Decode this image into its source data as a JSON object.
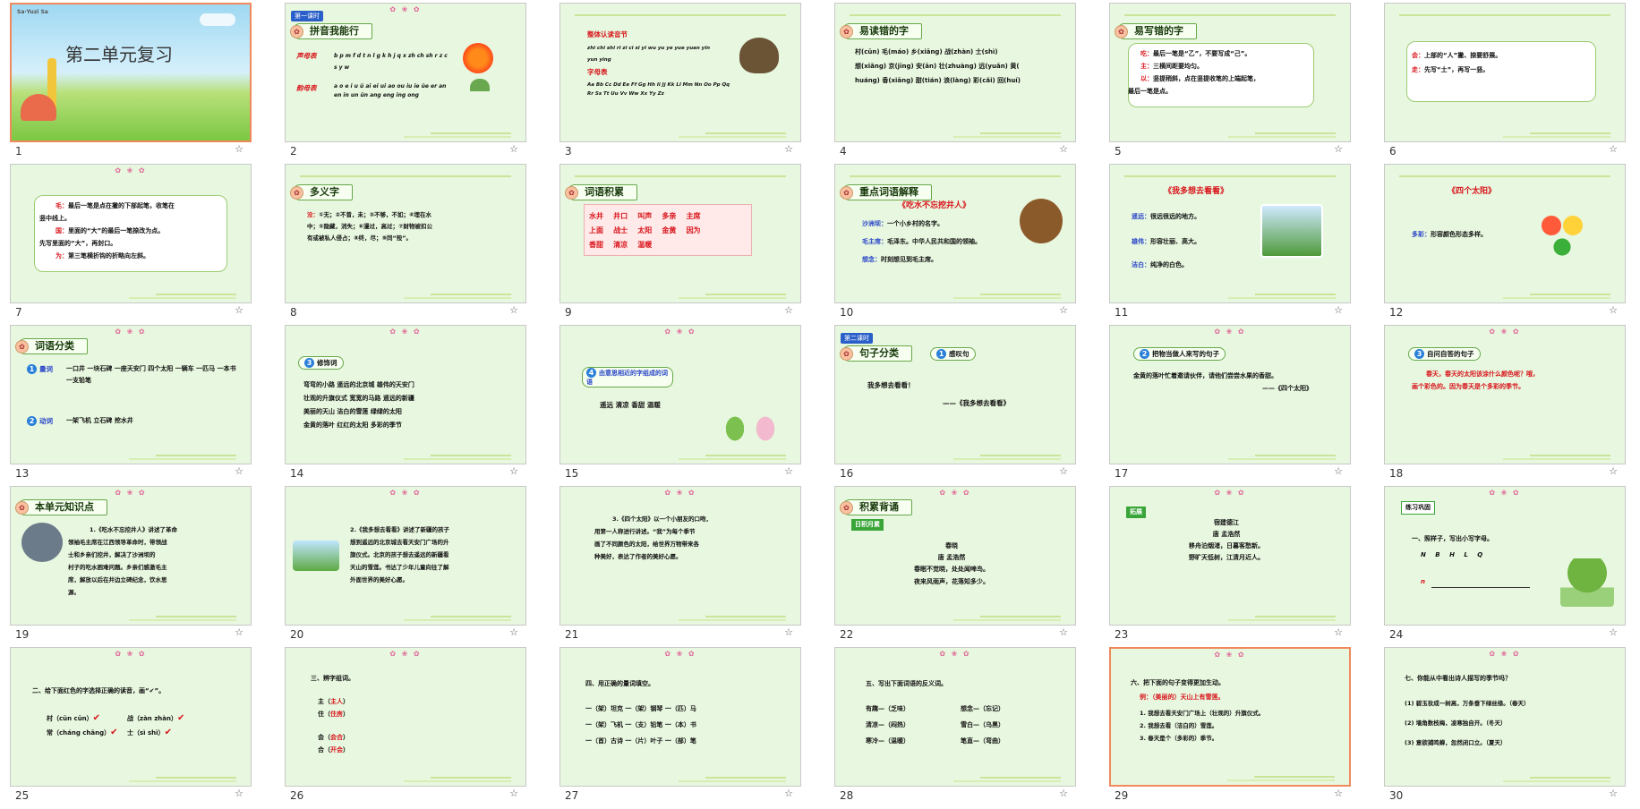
{
  "slides": [
    {
      "num": "1",
      "header": "Sa·Yuzi Sa",
      "title": "第二单元复习"
    },
    {
      "num": "2",
      "section": "第一课时",
      "tab": "拼音我能行",
      "l1": "声母表",
      "t1": "b p m f d t n l g k h j q x zh ch sh r z c s y w",
      "l2": "韵母表",
      "t2": "a o e i u ü ai ei ui ao ou iu ie üe er an en in un ün ang eng ing ong"
    },
    {
      "num": "3",
      "l1": "整体认读音节",
      "t1": "zhi chi shi ri zi ci si yi wu yu ye yue yuan yin yun ying",
      "l2": "字母表",
      "t2": "Aa Bb Cc Dd Ee Ff Gg Hh Ii Jj Kk Ll Mm Nn Oo Pp Qq Rr Ss Tt Uu Vv Ww Xx Yy Zz"
    },
    {
      "num": "4",
      "tab": "易读错的字",
      "l1": "村(cūn) 毛(máo) 乡(xiāng) 战(zhàn) 士(shì)",
      "l2": "想(xiǎng) 京(jīng) 安(ān) 壮(zhuàng) 远(yuǎn) 黄(",
      "l3": "huáng) 香(xiāng) 甜(tián) 浪(làng) 彩(cǎi) 回(huí)"
    },
    {
      "num": "5",
      "tab": "易写错的字",
      "k1": "吃：",
      "v1": "最后一笔是“乙”，不要写成“己”。",
      "k2": "主：",
      "v2": "三横间距要均匀。",
      "k3": "以：",
      "v3": "竖提稍斜，点在竖提收笔的上端起笔，",
      "v4": "最后一笔是点。"
    },
    {
      "num": "6",
      "k1": "会：",
      "v1": "上部的“人”撇、捺要舒展。",
      "k2": "走：",
      "v2": "先写“土”，再写一竖。"
    },
    {
      "num": "7",
      "k1": "毛：",
      "v1": "最后一笔是点在撇的下部起笔，收笔在",
      "v1b": "竖中线上。",
      "k2": "国：",
      "v2": "里面的“大”的最后一笔捺改为点。",
      "v2b": "先写里面的“大”，再封口。",
      "k3": "为：",
      "v3": "第三笔横折钩的折略向左斜。"
    },
    {
      "num": "8",
      "tab": "多义字",
      "k1": "没：",
      "v1": "①无；②不曾，未；③不够，不如；④埋在水",
      "v2": "中；⑤隐藏，消失；⑥漫过，高过；⑦财物被扣公",
      "v3": "有或被私人侵占；⑧终，尽；⑨同“殁”。"
    },
    {
      "num": "9",
      "tab": "词语积累",
      "words": [
        "水井",
        "井口",
        "叫声",
        "多亲",
        "主席",
        "上面",
        "战士",
        "太阳",
        "金黄",
        "因为",
        "香甜",
        "清凉",
        "温暖"
      ]
    },
    {
      "num": "10",
      "tab": "重点词语解释",
      "ttl": "《吃水不忘挖井人》",
      "k1": "沙洲坝：",
      "v1": "一个小乡村的名字。",
      "k2": "毛主席：",
      "v2": "毛泽东。中华人民共和国的领袖。",
      "k3": "想念：",
      "v3": "时刻想见到毛主席。"
    },
    {
      "num": "11",
      "ttl": "《我多想去看看》",
      "k1": "遥远：",
      "v1": "很远很远的地方。",
      "k2": "雄伟：",
      "v2": "形容壮丽、高大。",
      "k3": "洁白：",
      "v3": "纯净的白色。"
    },
    {
      "num": "12",
      "ttl": "《四个太阳》",
      "k1": "多彩：",
      "v1": "形容颜色形态多样。"
    },
    {
      "num": "13",
      "tab": "词语分类",
      "b1": "量词",
      "r1": "一口井 一块石碑 一座天安门 四个太阳 一辆车 一匹马 一本书 一支铅笔",
      "b2": "动词",
      "r2": "一架飞机 立石碑 挖水井"
    },
    {
      "num": "14",
      "tab": "修饰词",
      "r1": "弯弯的小路 遥远的北京城 雄伟的天安门",
      "r2": "壮观的升旗仪式 宽宽的马路 遥远的新疆",
      "r3": "美丽的天山 洁白的雪莲 绿绿的太阳",
      "r4": "金黄的落叶 红红的太阳 多彩的季节"
    },
    {
      "num": "15",
      "b1": "由意思相近的字组成的词语",
      "r1": "遥远 清凉 香甜 温暖"
    },
    {
      "num": "16",
      "section": "第二课时",
      "tab": "句子分类",
      "b1": "感叹句",
      "r1": "我多想去看看！",
      "r2": "——《我多想去看看》"
    },
    {
      "num": "17",
      "b1": "把物当做人来写的句子",
      "r1": "金黄的落叶忙着邀请伙伴，请他们尝尝水果的香甜。",
      "r2": "——《四个太阳》"
    },
    {
      "num": "18",
      "b1": "自问自答的句子",
      "r1": "春天，春天的太阳该涂什么颜色呢？哦，",
      "r2": "画个彩色的。因为春天是个多彩的季节。"
    },
    {
      "num": "19",
      "tab": "本单元知识点",
      "r1": "1.《吃水不忘挖井人》讲述了革命",
      "r2": "领袖毛主席在江西领导革命时，带领战",
      "r3": "士和乡亲们挖井，解决了沙洲坝的",
      "r4": "村子的吃水困难问题。乡亲们感激毛主",
      "r5": "席，解放以后在井边立碑纪念，饮水思",
      "r6": "源。"
    },
    {
      "num": "20",
      "r1": "2.《我多想去看看》讲述了新疆的孩子",
      "r2": "想到遥远的北京城去看天安门广场的升",
      "r3": "旗仪式。北京的孩子想去遥远的新疆看",
      "r4": "天山的雪莲。书达了少年儿童向往了解",
      "r5": "外面世界的美好心愿。"
    },
    {
      "num": "21",
      "r1": "3.《四个太阳》以一个小朋友的口吻，",
      "r2": "用第一人称进行讲述。“我”为每个季节",
      "r3": "画了不同颜色的太阳，给世界万物带来各",
      "r4": "种美好，表达了作者的美好心愿。"
    },
    {
      "num": "22",
      "tab": "积累背诵",
      "tag": "日积月累",
      "r1": "春晓",
      "r2": "唐 孟浩然",
      "r3": "春眠不觉晓，处处闻啼鸟。",
      "r4": "夜来风雨声，花落知多少。"
    },
    {
      "num": "23",
      "tag": "拓展",
      "r1": "宿建德江",
      "r2": "唐 孟浩然",
      "r3": "移舟泊烟渚，日暮客愁新。",
      "r4": "野旷天低树，江清月近人。"
    },
    {
      "num": "24",
      "tag": "练习巩固",
      "r1": "一、照样子，写出小写字母。",
      "r2": "N  B  H  L  Q",
      "r3": "n"
    },
    {
      "num": "25",
      "r1": "二、给下面红色的字选择正确的读音，画“✔”。",
      "r2": "村（cūn cūn）",
      "r3": "战（zàn zhàn）",
      "r4": "常（cháng chāng）",
      "r5": "士（sì shì）",
      "mark": "✔"
    },
    {
      "num": "26",
      "r1": "三、辨字组词。",
      "r2": "主（",
      "w2": "主人",
      "r3": "住（",
      "w3": "住房",
      "r4": "会（",
      "w4": "会合",
      "r5": "合（",
      "w5": "开会",
      "close": "）"
    },
    {
      "num": "27",
      "r1": "四、用正确的量词填空。",
      "r2": "一（架）坦克 一（架）钢琴 一（匹）马",
      "r3": "一（架）飞机 一（支）铅笔 一（本）书",
      "r4": "一（首）古诗 一（片）叶子 一（部）笔"
    },
    {
      "num": "28",
      "r1": "五、写出下面词语的反义词。",
      "r2": "有趣—（乏味）",
      "r3": "清凉—（闷热）",
      "r4": "寒冷—（温暖）",
      "r5": "想念—（忘记）",
      "r6": "雪白—（乌黑）",
      "r7": "笔直—（弯曲）"
    },
    {
      "num": "29",
      "r1": "六、把下面的句子变得更加生动。",
      "r2": "例：（美丽的）天山上有雪莲。",
      "r3": "1. 我想去看天安门广场上（壮观的）升旗仪式。",
      "r4": "2. 我想去看（洁白的）雪莲。",
      "r5": "3. 春天是个（多彩的）季节。"
    },
    {
      "num": "30",
      "r1": "七、你能从中看出诗人描写的季节吗？",
      "r2": "(1) 碧玉妆成一树高，万条垂下绿丝绦。（春天）",
      "r3": "(2) 墙角数枝梅，凌寒独自开。（冬天）",
      "r4": "(3) 意欲捕鸣蝉，忽然闭口立。（夏天）"
    }
  ],
  "icons": {
    "star": "☆",
    "flowers": "✿ ❀ ✿"
  },
  "colors": {
    "accent_red": "#d8141b",
    "thumb_bg": "#e8f7df",
    "selected_border": "#f08a5d"
  }
}
